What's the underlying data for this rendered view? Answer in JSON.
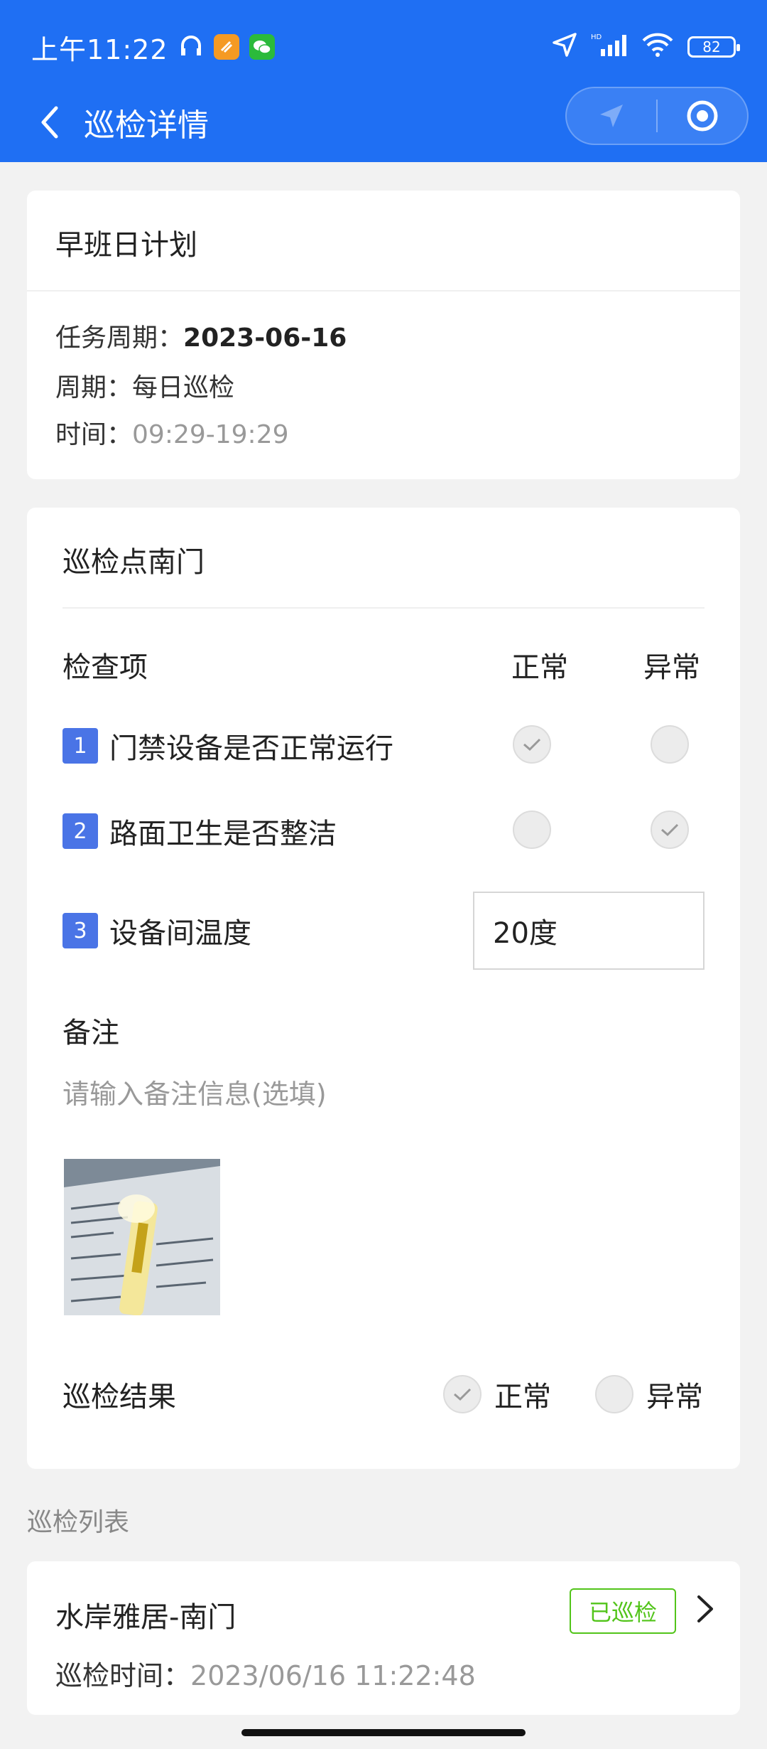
{
  "status_bar": {
    "time": "上午11:22",
    "battery": "82"
  },
  "nav": {
    "title": "巡检详情"
  },
  "plan": {
    "title": "早班日计划",
    "task_period_label": "任务周期：",
    "task_period_value": "2023-06-16",
    "cycle_label": "周期：",
    "cycle_value": "每日巡检",
    "time_label": "时间：",
    "time_value": "09:29-19:29"
  },
  "checkpoint": {
    "title": "巡检点南门",
    "header_item": "检查项",
    "header_normal": "正常",
    "header_abnormal": "异常",
    "items": [
      {
        "num": "1",
        "text": "门禁设备是否正常运行",
        "selected": "normal"
      },
      {
        "num": "2",
        "text": "路面卫生是否整洁",
        "selected": "abnormal"
      },
      {
        "num": "3",
        "text": "设备间温度",
        "value": "20度"
      }
    ],
    "remark_label": "备注",
    "remark_placeholder": "请输入备注信息(选填)",
    "result_label": "巡检结果",
    "result_normal": "正常",
    "result_abnormal": "异常",
    "result_selected": "normal"
  },
  "inspection_list": {
    "section_label": "巡检列表",
    "items": [
      {
        "name": "水岸雅居-南门",
        "status": "已巡检",
        "time_label": "巡检时间：",
        "time_value": "2023/06/16 11:22:48"
      }
    ]
  },
  "colors": {
    "header_blue": "#1f6ff3",
    "number_blue": "#4a74e6",
    "status_green": "#52c41a"
  }
}
